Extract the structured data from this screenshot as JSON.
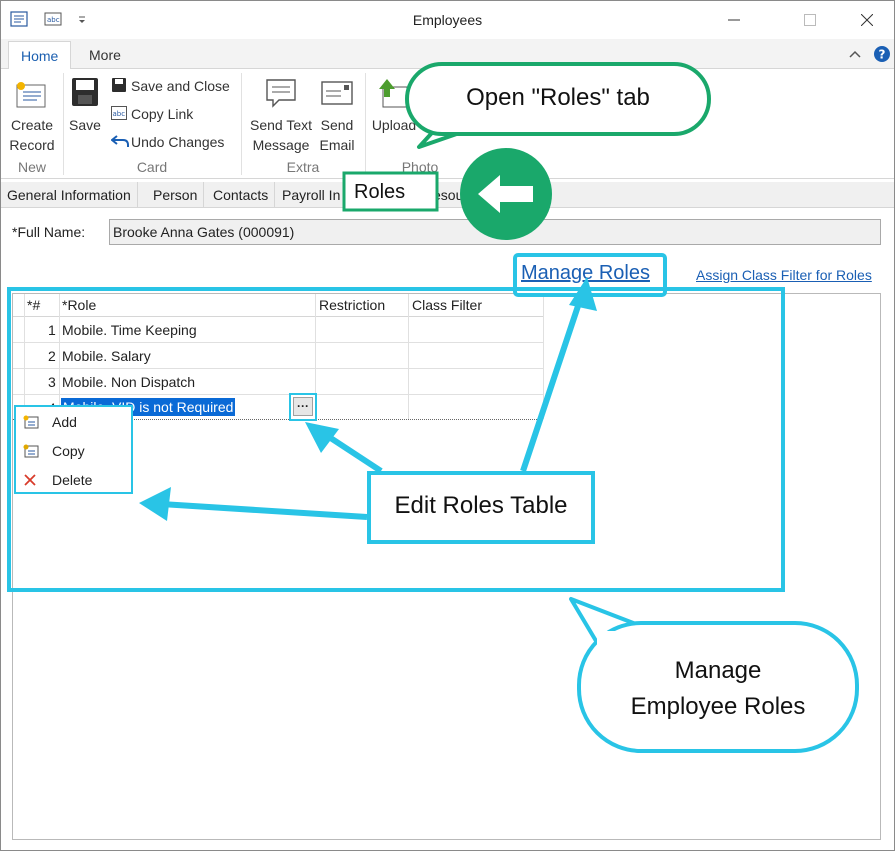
{
  "window": {
    "title": "Employees"
  },
  "ribbon_tabs": [
    {
      "label": "Home"
    },
    {
      "label": "More"
    }
  ],
  "ribbon": {
    "new_group": {
      "label": "New",
      "create_record": "Create\nRecord"
    },
    "card_group": {
      "label": "Card",
      "save": "Save",
      "save_and_close": "Save and Close",
      "copy_link": "Copy Link",
      "undo_changes": "Undo Changes"
    },
    "extra_group": {
      "label": "Extra",
      "send_text": "Send Text\nMessage",
      "send_email": "Send\nEmail"
    },
    "photo_group": {
      "label": "Photo",
      "upload": "Upload"
    }
  },
  "form_tabs": [
    {
      "label": "General Information"
    },
    {
      "label": "Person"
    },
    {
      "label": "Contacts"
    },
    {
      "label": "Payroll In"
    },
    {
      "label": "Roles"
    },
    {
      "label": "esou"
    }
  ],
  "full_name": {
    "label": "*Full Name:",
    "value": "Brooke Anna Gates (000091)"
  },
  "links": {
    "manage_roles": "Manage Roles",
    "assign_class_filter": "Assign Class Filter for Roles"
  },
  "grid": {
    "columns": [
      "*#",
      "*Role",
      "Restriction",
      "Class Filter"
    ],
    "rows": [
      {
        "num": "1",
        "role": "Mobile. Time Keeping"
      },
      {
        "num": "2",
        "role": "Mobile. Salary"
      },
      {
        "num": "3",
        "role": "Mobile. Non Dispatch"
      },
      {
        "num": "4",
        "role": "Mobile. VID is not Required"
      }
    ],
    "ellipsis": "···"
  },
  "context_menu": [
    {
      "label": "Add"
    },
    {
      "label": "Copy"
    },
    {
      "label": "Delete"
    }
  ],
  "callouts": {
    "open_roles": "Open \"Roles\" tab",
    "edit_table": "Edit Roles Table",
    "manage": "Manage\nEmployee Roles"
  },
  "colors": {
    "callout_cyan": "#29c4e6",
    "callout_green": "#1aa86b",
    "link_blue": "#1a5fb4",
    "selection_blue": "#0a6ad6"
  }
}
